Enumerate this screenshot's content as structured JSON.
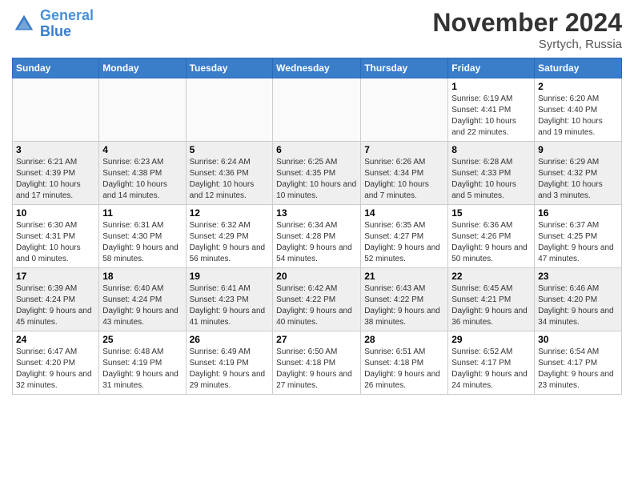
{
  "header": {
    "logo_line1": "General",
    "logo_line2": "Blue",
    "month": "November 2024",
    "location": "Syrtych, Russia"
  },
  "weekdays": [
    "Sunday",
    "Monday",
    "Tuesday",
    "Wednesday",
    "Thursday",
    "Friday",
    "Saturday"
  ],
  "weeks": [
    [
      {
        "day": "",
        "info": ""
      },
      {
        "day": "",
        "info": ""
      },
      {
        "day": "",
        "info": ""
      },
      {
        "day": "",
        "info": ""
      },
      {
        "day": "",
        "info": ""
      },
      {
        "day": "1",
        "info": "Sunrise: 6:19 AM\nSunset: 4:41 PM\nDaylight: 10 hours and 22 minutes."
      },
      {
        "day": "2",
        "info": "Sunrise: 6:20 AM\nSunset: 4:40 PM\nDaylight: 10 hours and 19 minutes."
      }
    ],
    [
      {
        "day": "3",
        "info": "Sunrise: 6:21 AM\nSunset: 4:39 PM\nDaylight: 10 hours and 17 minutes."
      },
      {
        "day": "4",
        "info": "Sunrise: 6:23 AM\nSunset: 4:38 PM\nDaylight: 10 hours and 14 minutes."
      },
      {
        "day": "5",
        "info": "Sunrise: 6:24 AM\nSunset: 4:36 PM\nDaylight: 10 hours and 12 minutes."
      },
      {
        "day": "6",
        "info": "Sunrise: 6:25 AM\nSunset: 4:35 PM\nDaylight: 10 hours and 10 minutes."
      },
      {
        "day": "7",
        "info": "Sunrise: 6:26 AM\nSunset: 4:34 PM\nDaylight: 10 hours and 7 minutes."
      },
      {
        "day": "8",
        "info": "Sunrise: 6:28 AM\nSunset: 4:33 PM\nDaylight: 10 hours and 5 minutes."
      },
      {
        "day": "9",
        "info": "Sunrise: 6:29 AM\nSunset: 4:32 PM\nDaylight: 10 hours and 3 minutes."
      }
    ],
    [
      {
        "day": "10",
        "info": "Sunrise: 6:30 AM\nSunset: 4:31 PM\nDaylight: 10 hours and 0 minutes."
      },
      {
        "day": "11",
        "info": "Sunrise: 6:31 AM\nSunset: 4:30 PM\nDaylight: 9 hours and 58 minutes."
      },
      {
        "day": "12",
        "info": "Sunrise: 6:32 AM\nSunset: 4:29 PM\nDaylight: 9 hours and 56 minutes."
      },
      {
        "day": "13",
        "info": "Sunrise: 6:34 AM\nSunset: 4:28 PM\nDaylight: 9 hours and 54 minutes."
      },
      {
        "day": "14",
        "info": "Sunrise: 6:35 AM\nSunset: 4:27 PM\nDaylight: 9 hours and 52 minutes."
      },
      {
        "day": "15",
        "info": "Sunrise: 6:36 AM\nSunset: 4:26 PM\nDaylight: 9 hours and 50 minutes."
      },
      {
        "day": "16",
        "info": "Sunrise: 6:37 AM\nSunset: 4:25 PM\nDaylight: 9 hours and 47 minutes."
      }
    ],
    [
      {
        "day": "17",
        "info": "Sunrise: 6:39 AM\nSunset: 4:24 PM\nDaylight: 9 hours and 45 minutes."
      },
      {
        "day": "18",
        "info": "Sunrise: 6:40 AM\nSunset: 4:24 PM\nDaylight: 9 hours and 43 minutes."
      },
      {
        "day": "19",
        "info": "Sunrise: 6:41 AM\nSunset: 4:23 PM\nDaylight: 9 hours and 41 minutes."
      },
      {
        "day": "20",
        "info": "Sunrise: 6:42 AM\nSunset: 4:22 PM\nDaylight: 9 hours and 40 minutes."
      },
      {
        "day": "21",
        "info": "Sunrise: 6:43 AM\nSunset: 4:22 PM\nDaylight: 9 hours and 38 minutes."
      },
      {
        "day": "22",
        "info": "Sunrise: 6:45 AM\nSunset: 4:21 PM\nDaylight: 9 hours and 36 minutes."
      },
      {
        "day": "23",
        "info": "Sunrise: 6:46 AM\nSunset: 4:20 PM\nDaylight: 9 hours and 34 minutes."
      }
    ],
    [
      {
        "day": "24",
        "info": "Sunrise: 6:47 AM\nSunset: 4:20 PM\nDaylight: 9 hours and 32 minutes."
      },
      {
        "day": "25",
        "info": "Sunrise: 6:48 AM\nSunset: 4:19 PM\nDaylight: 9 hours and 31 minutes."
      },
      {
        "day": "26",
        "info": "Sunrise: 6:49 AM\nSunset: 4:19 PM\nDaylight: 9 hours and 29 minutes."
      },
      {
        "day": "27",
        "info": "Sunrise: 6:50 AM\nSunset: 4:18 PM\nDaylight: 9 hours and 27 minutes."
      },
      {
        "day": "28",
        "info": "Sunrise: 6:51 AM\nSunset: 4:18 PM\nDaylight: 9 hours and 26 minutes."
      },
      {
        "day": "29",
        "info": "Sunrise: 6:52 AM\nSunset: 4:17 PM\nDaylight: 9 hours and 24 minutes."
      },
      {
        "day": "30",
        "info": "Sunrise: 6:54 AM\nSunset: 4:17 PM\nDaylight: 9 hours and 23 minutes."
      }
    ]
  ]
}
